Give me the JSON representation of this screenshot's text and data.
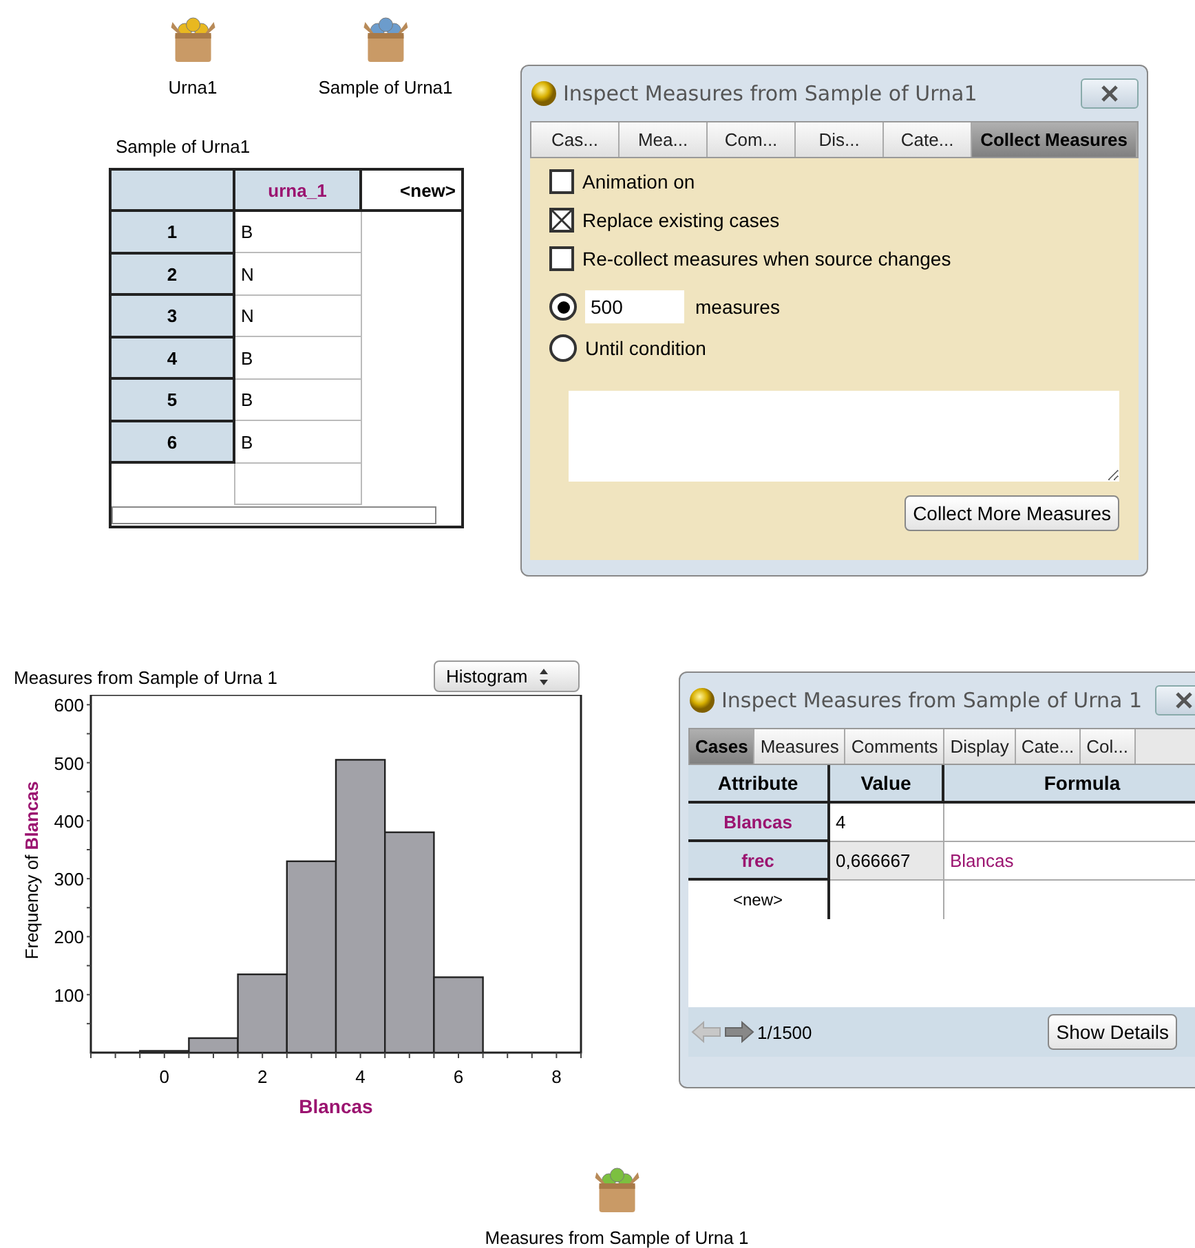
{
  "desktop_icons": [
    {
      "label": "Urna1",
      "color": "#e8b820"
    },
    {
      "label": "Sample of Urna1",
      "color": "#6c9ccc"
    },
    {
      "label": "Measures from Sample of Urna 1",
      "color": "#7cc040"
    }
  ],
  "case_table": {
    "title": "Sample of Urna1",
    "columns": [
      "urna_1",
      "<new>"
    ],
    "rows": [
      {
        "index": "1",
        "value": "B"
      },
      {
        "index": "2",
        "value": "N"
      },
      {
        "index": "3",
        "value": "N"
      },
      {
        "index": "4",
        "value": "B"
      },
      {
        "index": "5",
        "value": "B"
      },
      {
        "index": "6",
        "value": "B"
      }
    ]
  },
  "collect_inspector": {
    "title": "Inspect Measures from Sample of Urna1",
    "tabs": [
      {
        "label": "Cas...",
        "selected": false
      },
      {
        "label": "Mea...",
        "selected": false
      },
      {
        "label": "Com...",
        "selected": false
      },
      {
        "label": "Dis...",
        "selected": false
      },
      {
        "label": "Cate...",
        "selected": false
      },
      {
        "label": "Collect Measures",
        "selected": true
      }
    ],
    "options": [
      {
        "kind": "checkbox",
        "label": "Animation on",
        "checked": false
      },
      {
        "kind": "checkbox",
        "label": "Replace existing cases",
        "checked": true
      },
      {
        "kind": "checkbox",
        "label": "Re-collect measures when source changes",
        "checked": false
      },
      {
        "kind": "radio",
        "count_field": "500",
        "label": "measures",
        "selected": true
      },
      {
        "kind": "radio",
        "label": "Until condition",
        "selected": false
      }
    ],
    "button": "Collect More Measures"
  },
  "graph": {
    "title": "Measures from Sample of Urna 1",
    "plot_type": "Histogram",
    "chart_data": {
      "type": "bar",
      "xlabel": "Blancas",
      "ylabel": "Frequency of **Blancas**",
      "x": [
        0,
        1,
        2,
        3,
        4,
        5,
        6
      ],
      "values": [
        3,
        25,
        135,
        330,
        505,
        380,
        130
      ],
      "xlim": [
        -1.5,
        8.5
      ],
      "ylim": [
        0,
        617
      ],
      "xticks": [
        0,
        2,
        4,
        6,
        8
      ],
      "yticks": [
        100,
        200,
        300,
        400,
        500,
        600
      ]
    }
  },
  "cases_inspector": {
    "title": "Inspect Measures from Sample of Urna 1",
    "tabs": [
      {
        "label": "Cases",
        "selected": true
      },
      {
        "label": "Measures",
        "selected": false
      },
      {
        "label": "Comments",
        "selected": false
      },
      {
        "label": "Display",
        "selected": false
      },
      {
        "label": "Cate...",
        "selected": false
      },
      {
        "label": "Col...",
        "selected": false
      }
    ],
    "columns": [
      "Attribute",
      "Value",
      "Formula"
    ],
    "rows": [
      {
        "kind": "attribute",
        "attribute": "Blancas",
        "value": "4"
      },
      {
        "kind": "attribute",
        "attribute": "frec",
        "value": "0,666667",
        "formula": "Blancas",
        "computed": true
      },
      {
        "kind": "new",
        "attribute": "<new>"
      }
    ],
    "case_counter": "1/1500",
    "button": "Show Details"
  }
}
